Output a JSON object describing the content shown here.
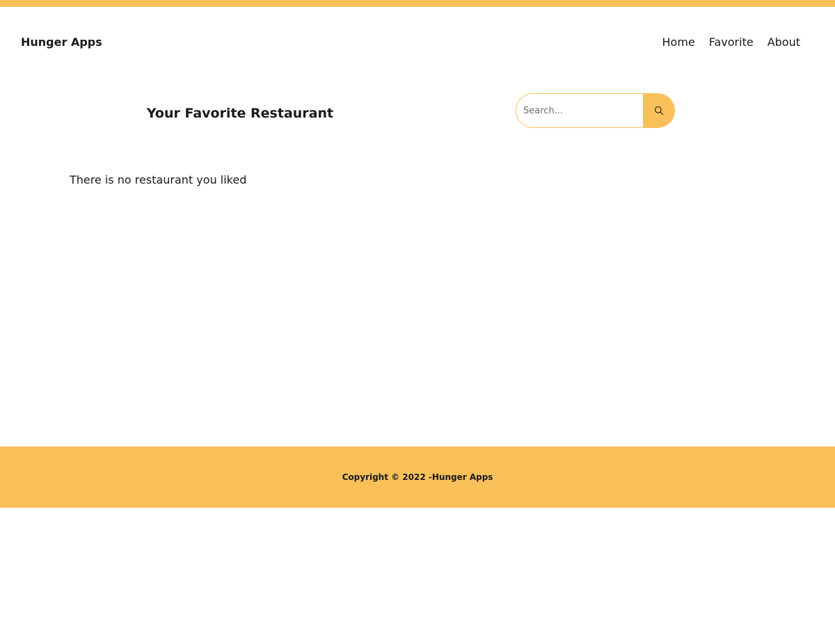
{
  "brand": {
    "name": "Hunger Apps"
  },
  "nav": {
    "items": [
      {
        "label": "Home"
      },
      {
        "label": "Favorite"
      },
      {
        "label": "About"
      }
    ]
  },
  "main": {
    "title": "Your Favorite Restaurant",
    "search": {
      "placeholder": "Search...",
      "value": "",
      "icon": "search-icon"
    },
    "empty_message": "There is no restaurant you liked"
  },
  "footer": {
    "copyright_prefix": "Copyright © 2022 -",
    "copyright_brand": "Hunger Apps"
  },
  "colors": {
    "accent": "#f9c05a",
    "text": "#1a1a1a",
    "background": "#ffffff"
  }
}
